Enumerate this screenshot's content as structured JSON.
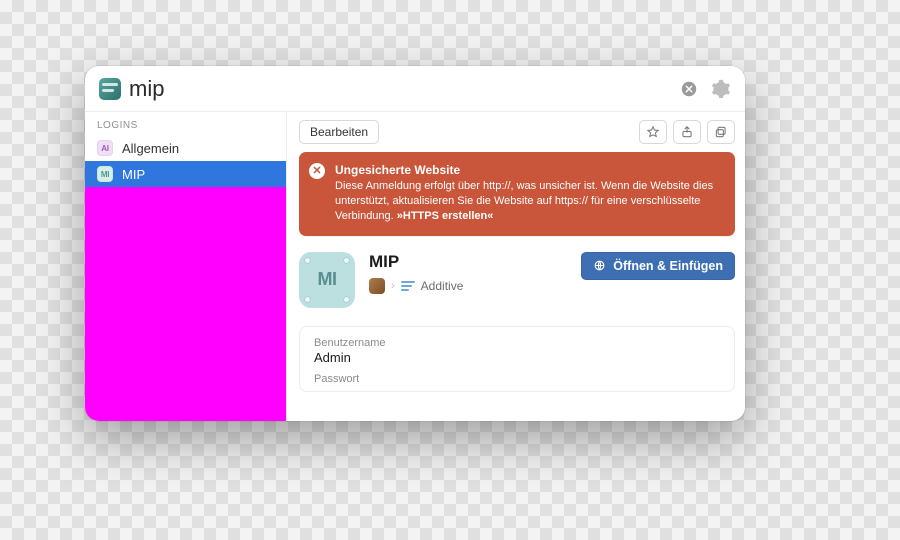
{
  "search": {
    "value": "mip"
  },
  "sidebar": {
    "section_label": "LOGINS",
    "items": [
      {
        "label": "Allgemein",
        "badge": "AI"
      },
      {
        "label": "MIP",
        "badge": "MI"
      }
    ]
  },
  "toolbar": {
    "edit_label": "Bearbeiten"
  },
  "warning": {
    "title": "Ungesicherte Website",
    "body": "Diese Anmeldung erfolgt über http://, was unsicher ist. Wenn die Website dies unterstützt, aktualisieren Sie die Website auf https:// für eine verschlüsselte Verbindung. ",
    "action": "»HTTPS erstellen«",
    "color": "#c9553a"
  },
  "entry": {
    "title": "MIP",
    "icon_letters": "MI",
    "breadcrumb": {
      "vault": "Additive"
    },
    "primary_action": "Öffnen & Einfügen"
  },
  "fields": {
    "username_label": "Benutzername",
    "username_value": "Admin",
    "password_label": "Passwort"
  },
  "colors": {
    "accent": "#3f6fb3",
    "selection": "#2f76df",
    "warning": "#c9553a"
  }
}
